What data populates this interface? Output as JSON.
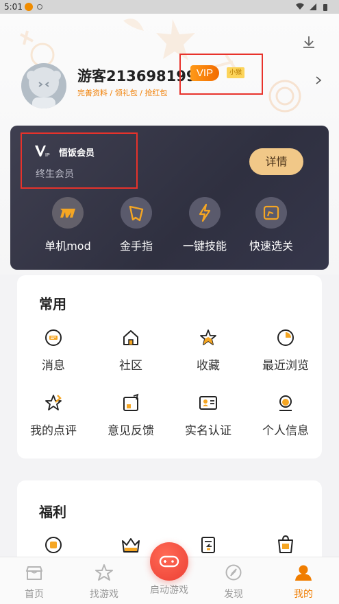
{
  "status_bar": {
    "time": "5:01"
  },
  "profile": {
    "username": "游客213698199",
    "vip_badge": "VIP",
    "level_badge": "小猴",
    "links": "完善资料 / 领礼包 / 抢红包"
  },
  "vip_card": {
    "logo_text": "悟饭会员",
    "subtitle": "终生会员",
    "detail_button": "详情",
    "features": [
      {
        "label": "单机mod",
        "icon": "mod-icon"
      },
      {
        "label": "金手指",
        "icon": "golden-finger-icon"
      },
      {
        "label": "一键技能",
        "icon": "lightning-icon"
      },
      {
        "label": "快速选关",
        "icon": "level-select-icon"
      }
    ]
  },
  "common": {
    "title": "常用",
    "items": [
      {
        "label": "消息",
        "icon": "message-icon"
      },
      {
        "label": "社区",
        "icon": "community-icon"
      },
      {
        "label": "收藏",
        "icon": "favorite-icon"
      },
      {
        "label": "最近浏览",
        "icon": "recent-icon"
      },
      {
        "label": "我的点评",
        "icon": "review-icon"
      },
      {
        "label": "意见反馈",
        "icon": "feedback-icon"
      },
      {
        "label": "实名认证",
        "icon": "id-card-icon"
      },
      {
        "label": "个人信息",
        "icon": "personal-info-icon"
      }
    ]
  },
  "welfare": {
    "title": "福利",
    "items": [
      {
        "icon": "coin-icon"
      },
      {
        "icon": "crown-icon"
      },
      {
        "icon": "exchange-icon"
      },
      {
        "icon": "vip-bag-icon"
      }
    ]
  },
  "tab_bar": {
    "tabs": [
      {
        "label": "首页",
        "icon": "home-icon"
      },
      {
        "label": "找游戏",
        "icon": "star-icon"
      },
      {
        "label": "启动游戏",
        "icon": "gamepad-icon"
      },
      {
        "label": "发现",
        "icon": "compass-icon"
      },
      {
        "label": "我的",
        "icon": "user-icon"
      }
    ],
    "active": "我的"
  },
  "colors": {
    "accent": "#f07d00",
    "vip_card_bg": "#2f3040",
    "highlight_box": "#e8322b",
    "launch_button": "#ec3f34"
  }
}
